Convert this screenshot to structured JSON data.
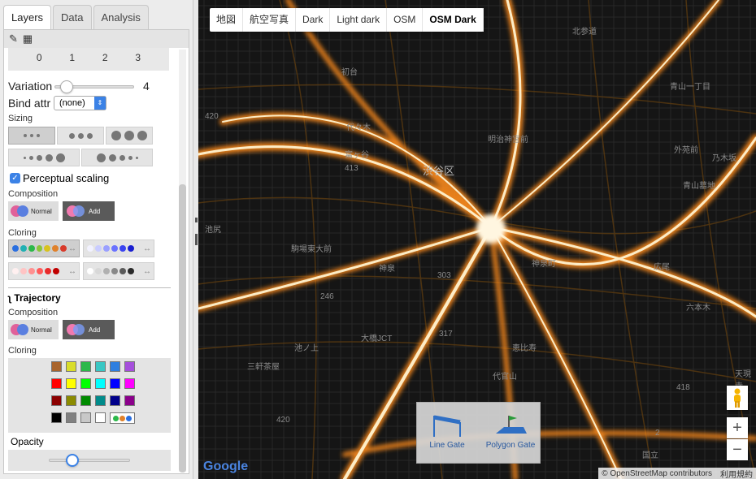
{
  "tabs": [
    {
      "label": "Layers"
    },
    {
      "label": "Data"
    },
    {
      "label": "Analysis"
    }
  ],
  "toolbar": {
    "wand": "wand-icon",
    "grid": "grid-icon"
  },
  "sizing_ticks": [
    "0",
    "1",
    "2",
    "3"
  ],
  "variation": {
    "label": "Variation",
    "value": "4",
    "level_fraction": 0.08
  },
  "bind_attr": {
    "label": "Bind attr",
    "selected": "(none)"
  },
  "sizing_label": "Sizing",
  "perceptual": {
    "label": "Perceptual scaling",
    "checked": true
  },
  "composition_label": "Composition",
  "composition_opts": {
    "normal": "Normal",
    "add": "Add"
  },
  "cloring_label": "Cloring",
  "trajectory": {
    "title": "Trajectory",
    "composition_label": "Composition",
    "cloring_label": "Cloring"
  },
  "palette": [
    [
      "#a8642c",
      "#d9dd2a",
      "#2cb84a",
      "#39c7c4",
      "#2f7fe0",
      "#a64fdc"
    ],
    [
      "#ff0000",
      "#ffff00",
      "#00ff00",
      "#00ffff",
      "#0000ff",
      "#ff00ff"
    ],
    [
      "#8b0000",
      "#8b8b00",
      "#008b00",
      "#008b8b",
      "#00008b",
      "#8b008b"
    ],
    [
      "#000000",
      "#808080",
      "#c8c8c8",
      "#ffffff"
    ]
  ],
  "opacity": {
    "label": "Opacity",
    "level_fraction": 0.25
  },
  "map": {
    "tabs": [
      {
        "label": "地図"
      },
      {
        "label": "航空写真"
      },
      {
        "label": "Dark"
      },
      {
        "label": "Light dark"
      },
      {
        "label": "OSM"
      },
      {
        "label": "OSM Dark"
      }
    ],
    "district": "渋谷区",
    "labels": [
      "初台",
      "代々木",
      "富ヶ谷",
      "駒場東大前",
      "神泉",
      "池尻",
      "大橋JCT",
      "三軒茶屋",
      "池ノ上",
      "神泉町",
      "青山一丁目",
      "乃木坂",
      "青山墓地",
      "明治神宮前",
      "北参道",
      "恵比寿",
      "代官山",
      "外苑前",
      "広尾",
      "六本木",
      "天現寺",
      "国立"
    ],
    "route_numbers": [
      "420",
      "413",
      "246",
      "317",
      "303",
      "418",
      "420",
      "2"
    ],
    "gates": {
      "line": "Line Gate",
      "polygon": "Polygon Gate"
    },
    "attribution": "© OpenStreetMap contributors",
    "terms": "利用規約",
    "zoom_in": "+",
    "zoom_out": "−",
    "google": "Google"
  }
}
